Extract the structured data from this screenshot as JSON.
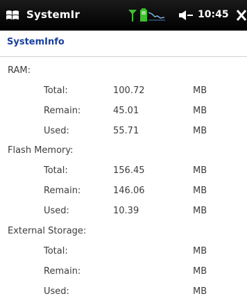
{
  "status_bar": {
    "app_title": "SystemIr",
    "time": "10:45",
    "icons": [
      "windows-start-icon",
      "signal-icon",
      "battery-icon",
      "graph-icon",
      "volume-icon",
      "close-icon"
    ],
    "colors": {
      "bar_bg": "#000000",
      "accent_green": "#3fbf2f",
      "text": "#ffffff"
    }
  },
  "header": {
    "title": "SystemInfo",
    "title_color": "#1a3f9c"
  },
  "sections": [
    {
      "label": "RAM:",
      "rows": [
        {
          "label": "Total:",
          "value": "100.72",
          "unit": "MB"
        },
        {
          "label": "Remain:",
          "value": "45.01",
          "unit": "MB"
        },
        {
          "label": "Used:",
          "value": "55.71",
          "unit": "MB"
        }
      ]
    },
    {
      "label": "Flash Memory:",
      "rows": [
        {
          "label": "Total:",
          "value": "156.45",
          "unit": "MB"
        },
        {
          "label": "Remain:",
          "value": "146.06",
          "unit": "MB"
        },
        {
          "label": "Used:",
          "value": "10.39",
          "unit": "MB"
        }
      ]
    },
    {
      "label": "External Storage:",
      "rows": [
        {
          "label": "Total:",
          "value": "",
          "unit": "MB"
        },
        {
          "label": "Remain:",
          "value": "",
          "unit": "MB"
        },
        {
          "label": "Used:",
          "value": "",
          "unit": "MB"
        }
      ]
    }
  ]
}
